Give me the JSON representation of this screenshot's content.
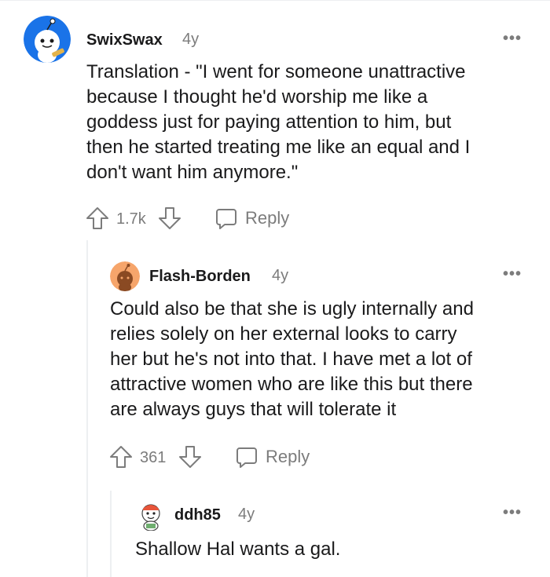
{
  "comments": [
    {
      "username": "SwixSwax",
      "age": "4y",
      "body": [
        "Translation - \"I went for someone unattractive",
        "because I thought he'd worship me like a",
        "goddess just for paying attention to him, but",
        "then he started treating me like an equal and I",
        "don't want him anymore.\""
      ],
      "score": "1.7k",
      "reply_label": "Reply",
      "more_label": "•••",
      "avatar_icon": "snoo-avatar-blue",
      "accent_color": "#1a73e8"
    },
    {
      "username": "Flash-Borden",
      "age": "4y",
      "body": [
        "Could also be that she is ugly internally and",
        "relies solely on her external looks to carry",
        "her but he's not into that. I have met a lot of",
        "attractive women who are like this but there",
        "are always guys that will tolerate it"
      ],
      "score": "361",
      "reply_label": "Reply",
      "more_label": "•••",
      "avatar_icon": "snoo-avatar-orange",
      "accent_color": "#f6a56b"
    },
    {
      "username": "ddh85",
      "age": "4y",
      "body": [
        "Shallow Hal wants a gal."
      ],
      "more_label": "•••",
      "avatar_icon": "snoo-avatar-white",
      "accent_color": "#e8553a"
    }
  ]
}
